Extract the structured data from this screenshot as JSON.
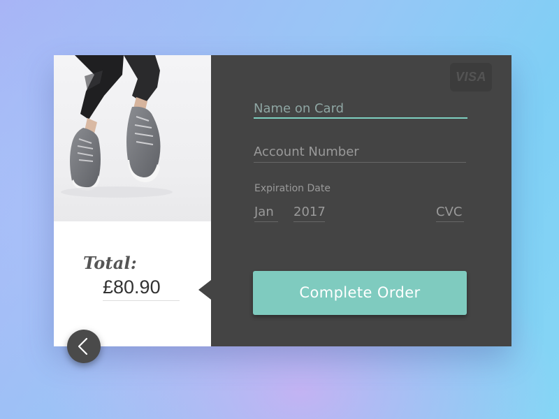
{
  "product": {
    "image_alt": "grey knit sneakers"
  },
  "summary": {
    "total_label": "Total:",
    "total_amount": "£80.90"
  },
  "payment": {
    "card_brand": "VISA",
    "name_placeholder": "Name on Card",
    "account_placeholder": "Account Number",
    "expiration_label": "Expiration Date",
    "expiration_month": "Jan",
    "expiration_year": "2017",
    "cvc_placeholder": "CVC",
    "complete_label": "Complete Order"
  },
  "colors": {
    "accent": "#7fcbbf",
    "panel": "#444444",
    "field_line": "#676767",
    "active_line": "#7ed0c1"
  },
  "icons": {
    "back": "chevron-left-icon",
    "card": "visa-icon"
  }
}
